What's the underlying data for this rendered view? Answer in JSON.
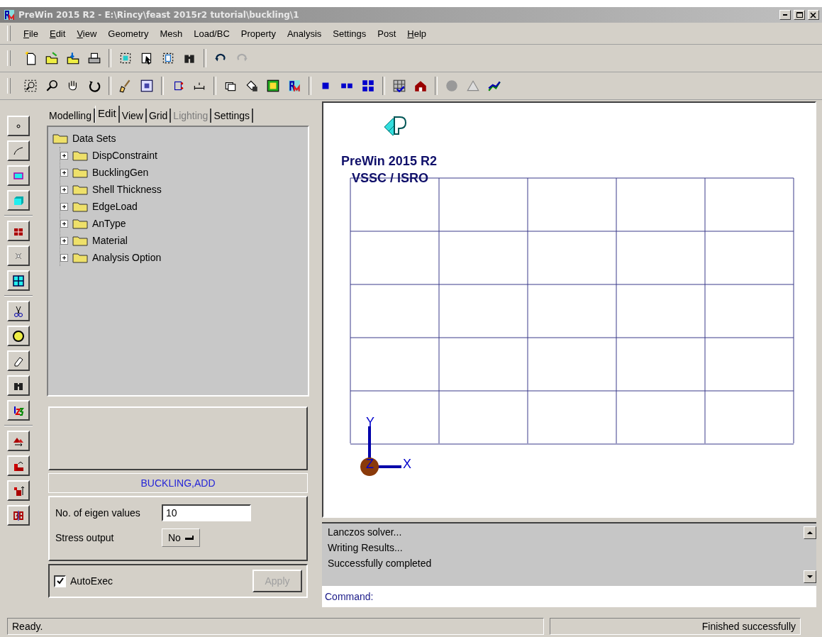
{
  "window": {
    "title": "PreWin 2015 R2 - E:\\Rincy\\feast 2015r2 tutorial\\buckling\\1"
  },
  "menu": [
    {
      "label": "File",
      "mnemonic": true
    },
    {
      "label": "Edit",
      "mnemonic": true
    },
    {
      "label": "View",
      "mnemonic": true
    },
    {
      "label": "Geometry",
      "mnemonic": false
    },
    {
      "label": "Mesh",
      "mnemonic": false
    },
    {
      "label": "Load/BC",
      "mnemonic": false
    },
    {
      "label": "Property",
      "mnemonic": false
    },
    {
      "label": "Analysis",
      "mnemonic": false
    },
    {
      "label": "Settings",
      "mnemonic": false
    },
    {
      "label": "Post",
      "mnemonic": false
    },
    {
      "label": "Help",
      "mnemonic": true
    }
  ],
  "tabs": [
    {
      "label": "Modelling",
      "selected": false,
      "disabled": false
    },
    {
      "label": "Edit",
      "selected": true,
      "disabled": false
    },
    {
      "label": "View",
      "selected": false,
      "disabled": false
    },
    {
      "label": "Grid",
      "selected": false,
      "disabled": false
    },
    {
      "label": "Lighting",
      "selected": false,
      "disabled": true
    },
    {
      "label": "Settings",
      "selected": false,
      "disabled": false
    }
  ],
  "tree": {
    "label": "Data Sets",
    "expanded": true,
    "children": [
      {
        "label": "DispConstraint",
        "expanded": false
      },
      {
        "label": "BucklingGen",
        "expanded": false
      },
      {
        "label": "Shell Thickness",
        "expanded": false
      },
      {
        "label": "EdgeLoad",
        "expanded": false
      },
      {
        "label": "AnType",
        "expanded": false
      },
      {
        "label": "Material",
        "expanded": false
      },
      {
        "label": "Analysis Option",
        "expanded": false
      }
    ]
  },
  "form": {
    "title": "BUCKLING,ADD",
    "fields": [
      {
        "kind": "text",
        "label": "No. of eigen values",
        "value": "10"
      },
      {
        "kind": "toggle",
        "label": "Stress output",
        "value": "No"
      }
    ],
    "autoexec": {
      "label": "AutoExec",
      "checked": true
    },
    "apply": {
      "label": "Apply",
      "disabled": true
    }
  },
  "viewport": {
    "logo_title": "PreWin 2015 R2",
    "logo_subtitle": "VSSC / ISRO",
    "axes": {
      "x": "X",
      "y": "Y",
      "z": "Z"
    }
  },
  "log": [
    "Lanczos solver...",
    "Writing Results...",
    "Successfully completed"
  ],
  "command": {
    "label": "Command:"
  },
  "status_bar": {
    "left": "Ready.",
    "right": "Finished successfully"
  }
}
